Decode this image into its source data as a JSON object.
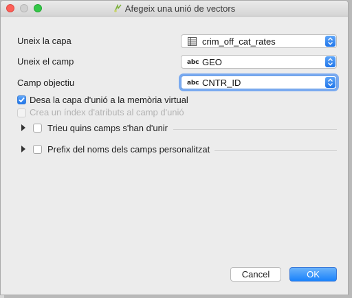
{
  "window": {
    "title": "Afegeix una unió de vectors"
  },
  "form": {
    "join_layer": {
      "label": "Uneix la capa",
      "value": "crim_off_cat_rates",
      "icon": "table-icon"
    },
    "join_field": {
      "label": "Uneix el camp",
      "value": "GEO",
      "type_badge": "abc"
    },
    "target_field": {
      "label": "Camp objectiu",
      "value": "CNTR_ID",
      "type_badge": "abc"
    }
  },
  "options": {
    "cache_virtual": {
      "label": "Desa la capa d'unió a la memòria virtual",
      "checked": true
    },
    "create_index": {
      "label": "Crea un índex d'atributs al camp d'unió",
      "checked": false,
      "enabled": false
    },
    "choose_fields": {
      "label": "Trieu quins camps s'han d'unir",
      "checked": false
    },
    "custom_prefix": {
      "label": "Prefix del noms dels camps personalitzat",
      "checked": false
    }
  },
  "buttons": {
    "cancel": "Cancel",
    "ok": "OK"
  },
  "colors": {
    "accent": "#1f75ea",
    "focus_ring": "#7aaaf0"
  }
}
